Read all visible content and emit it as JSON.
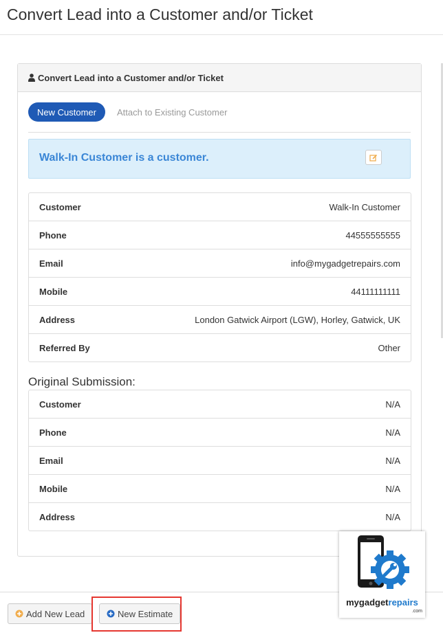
{
  "page": {
    "title": "Convert Lead into a Customer and/or Ticket"
  },
  "panel": {
    "heading": "Convert Lead into a Customer and/or Ticket",
    "tabs": [
      {
        "label": "New Customer",
        "active": true
      },
      {
        "label": "Attach to Existing Customer",
        "active": false
      }
    ],
    "alert": "Walk-In Customer is a customer.",
    "customer_details": [
      {
        "label": "Customer",
        "value": "Walk-In Customer"
      },
      {
        "label": "Phone",
        "value": "44555555555"
      },
      {
        "label": "Email",
        "value": "info@mygadgetrepairs.com"
      },
      {
        "label": "Mobile",
        "value": "44111111111"
      },
      {
        "label": "Address",
        "value": "London Gatwick Airport (LGW), Horley, Gatwick, UK"
      },
      {
        "label": "Referred By",
        "value": "Other"
      }
    ],
    "original_heading": "Original Submission:",
    "original_submission": [
      {
        "label": "Customer",
        "value": "N/A"
      },
      {
        "label": "Phone",
        "value": "N/A"
      },
      {
        "label": "Email",
        "value": "N/A"
      },
      {
        "label": "Mobile",
        "value": "N/A"
      },
      {
        "label": "Address",
        "value": "N/A"
      }
    ]
  },
  "footer": {
    "add_lead_label": "Add New Lead",
    "new_estimate_label": "New Estimate"
  },
  "logo": {
    "text_main": "mygadget",
    "text_accent": "repairs",
    "text_suffix": ".com"
  },
  "colors": {
    "primary": "#1f5ab5",
    "alert_bg": "#dceffb",
    "alert_text": "#3a86d6",
    "add_icon": "#f0ad4e",
    "estimate_icon": "#2a6cc4",
    "highlight": "#e5362f"
  },
  "icons": {
    "heading": "user-icon",
    "edit": "edit-icon",
    "add_lead": "plus-circle-icon",
    "new_estimate": "plus-circle-icon"
  }
}
